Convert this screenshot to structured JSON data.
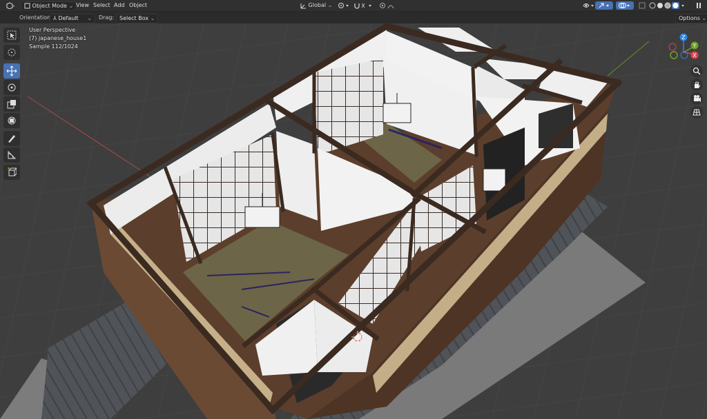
{
  "header": {
    "editor_icon": "cube-editor-icon",
    "mode_label": "Object Menu",
    "mode": "Object Mode",
    "menus": [
      "View",
      "Select",
      "Add",
      "Object"
    ],
    "transform_orientation": "Global",
    "options_label": "Options"
  },
  "tool_settings": {
    "orientation_label": "Orientation:",
    "orientation_value": "Default",
    "drag_label": "Drag:",
    "drag_value": "Select Box"
  },
  "viewport": {
    "view_name": "User Perspective",
    "object_info": "(7) japanese_house1",
    "sample": "Sample 112/1024",
    "gizmo_axes": {
      "z": "Z",
      "y": "Y",
      "x": "X"
    }
  },
  "toolbar": {
    "tools": [
      "select-box",
      "cursor",
      "move",
      "rotate",
      "scale",
      "transform",
      "annotate",
      "measure",
      "add-cube"
    ],
    "active_tool": "move"
  },
  "colors": {
    "header_bg": "#303030",
    "active": "#4772b3",
    "viewport_bg": "#3d3d3d",
    "x_axis": "#e0444e",
    "y_axis": "#6ea325",
    "z_axis": "#2f84e3"
  }
}
